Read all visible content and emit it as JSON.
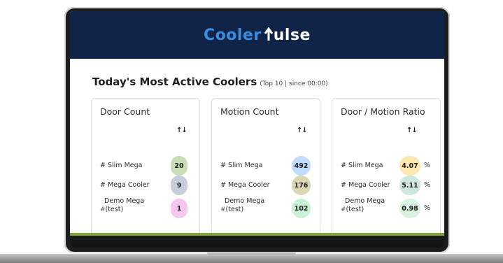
{
  "brand": {
    "part1": "Cooler",
    "part2": "ulse"
  },
  "section": {
    "title": "Today's Most Active Coolers",
    "subtitle": "(Top 10 | since 00:00)"
  },
  "cards": [
    {
      "title": "Door Count",
      "sort_glyph": "↑↓",
      "rows": [
        {
          "name": "# Slim Mega",
          "value": "20",
          "color": "#c8ddb4"
        },
        {
          "name": "# Mega Cooler",
          "value": "9",
          "color": "#c9ccdc"
        },
        {
          "name_line1": "Demo Mega",
          "name_line2": "(test)",
          "hash": "#",
          "value": "1",
          "color": "#f7c6ef"
        }
      ]
    },
    {
      "title": "Motion Count",
      "sort_glyph": "↑↓",
      "rows": [
        {
          "name": "# Slim Mega",
          "value": "492",
          "color": "#bfdcff"
        },
        {
          "name": "# Mega Cooler",
          "value": "176",
          "color": "#dcd7b3"
        },
        {
          "name_line1": "Demo Mega",
          "name_line2": "(test)",
          "hash": "#",
          "value": "102",
          "color": "#c7f2d8"
        }
      ]
    },
    {
      "title": "Door / Motion Ratio",
      "sort_glyph": "↑↓",
      "unit": "%",
      "rows": [
        {
          "name": "# Slim Mega",
          "value": "4.07",
          "color": "#fce7b0"
        },
        {
          "name": "# Mega Cooler",
          "value": "5.11",
          "color": "#cfe7dc"
        },
        {
          "name_line1": "Demo Mega",
          "name_line2": "(test)",
          "hash": "#",
          "value": "0.98",
          "color": "#d9f3e3"
        }
      ]
    }
  ],
  "colors": {
    "header_bg": "#0f2447",
    "brand_blue": "#3b8ee0",
    "accent_green": "#8db83a"
  }
}
